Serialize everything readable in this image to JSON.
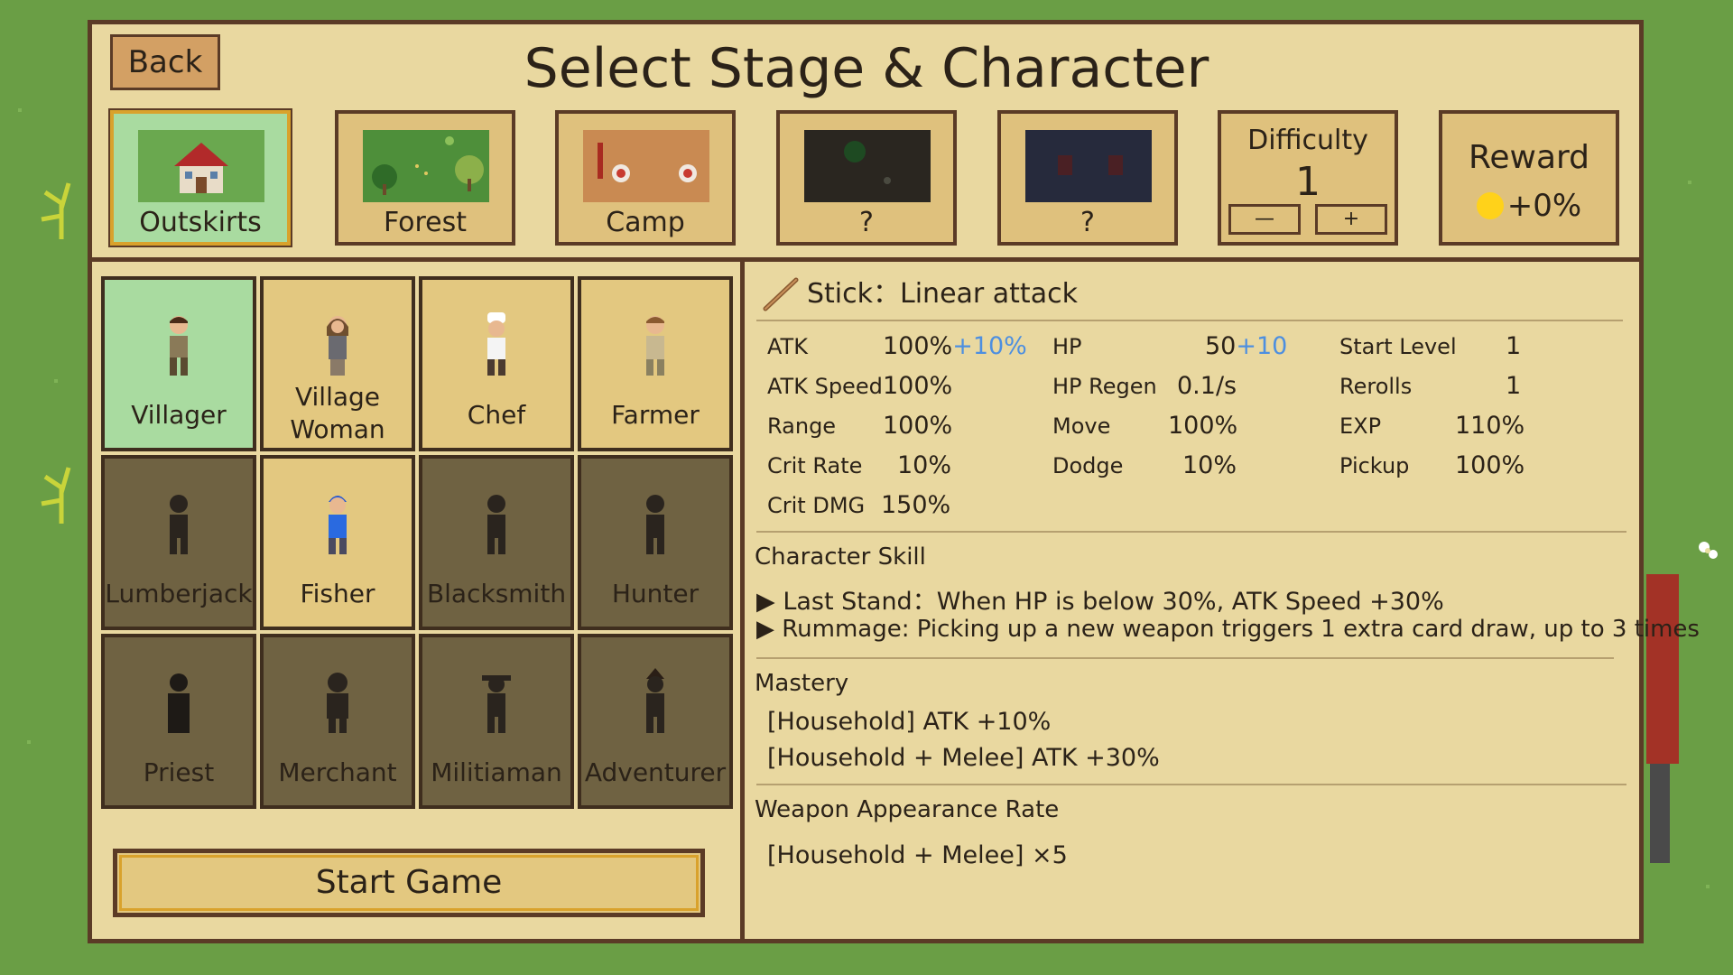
{
  "header": {
    "back_label": "Back",
    "title": "Select Stage & Character"
  },
  "stages": [
    {
      "label": "Outskirts",
      "selected": true
    },
    {
      "label": "Forest",
      "selected": false
    },
    {
      "label": "Camp",
      "selected": false
    },
    {
      "label": "?",
      "selected": false
    },
    {
      "label": "?",
      "selected": false
    }
  ],
  "difficulty": {
    "title": "Difficulty",
    "value": "1",
    "minus": "—",
    "plus": "+"
  },
  "reward": {
    "title": "Reward",
    "value": "+0%"
  },
  "characters": [
    {
      "name": "Villager",
      "state": "selected"
    },
    {
      "name": "Village Woman",
      "state": "unlocked"
    },
    {
      "name": "Chef",
      "state": "unlocked"
    },
    {
      "name": "Farmer",
      "state": "unlocked"
    },
    {
      "name": "Lumberjack",
      "state": "locked"
    },
    {
      "name": "Fisher",
      "state": "unlocked"
    },
    {
      "name": "Blacksmith",
      "state": "locked"
    },
    {
      "name": "Hunter",
      "state": "locked"
    },
    {
      "name": "Priest",
      "state": "locked"
    },
    {
      "name": "Merchant",
      "state": "locked"
    },
    {
      "name": "Militiaman",
      "state": "locked"
    },
    {
      "name": "Adventurer",
      "state": "locked"
    }
  ],
  "start_label": "Start Game",
  "detail": {
    "weapon": "Stick：Linear attack",
    "stats_col1": [
      {
        "label": "ATK",
        "value": "100%",
        "bonus": "+10%"
      },
      {
        "label": "ATK Speed",
        "value": "100%",
        "bonus": ""
      },
      {
        "label": "Range",
        "value": "100%",
        "bonus": ""
      },
      {
        "label": "Crit Rate",
        "value": "10%",
        "bonus": ""
      },
      {
        "label": "Crit DMG",
        "value": "150%",
        "bonus": ""
      }
    ],
    "stats_col2": [
      {
        "label": "HP",
        "value": "50",
        "bonus": "+10"
      },
      {
        "label": "HP Regen",
        "value": "0.1/s",
        "bonus": ""
      },
      {
        "label": "Move",
        "value": "100%",
        "bonus": ""
      },
      {
        "label": "Dodge",
        "value": "10%",
        "bonus": ""
      }
    ],
    "stats_col3": [
      {
        "label": "Start Level",
        "value": "1"
      },
      {
        "label": "Rerolls",
        "value": "1"
      },
      {
        "label": "EXP",
        "value": "110%"
      },
      {
        "label": "Pickup",
        "value": "100%"
      }
    ],
    "skill_title": "Character Skill",
    "skills": [
      "▶ Last Stand：When HP is below 30%, ATK Speed +30%",
      "▶ Rummage: Picking up a new weapon triggers 1 extra card draw, up to 3 times"
    ],
    "mastery_title": "Mastery",
    "mastery": [
      "[Household]  ATK +10%",
      "[Household + Melee]  ATK +30%"
    ],
    "weapon_rate_title": "Weapon Appearance Rate",
    "weapon_rate": "[Household + Melee]  ×5"
  },
  "colors": {
    "panel_bg": "#e9d8a0",
    "border": "#5b3b26",
    "selected_bg": "#a9dba0",
    "locked_bg": "#6f6242",
    "bonus_blue": "#4d8fe0",
    "coin": "#ffd21a"
  }
}
